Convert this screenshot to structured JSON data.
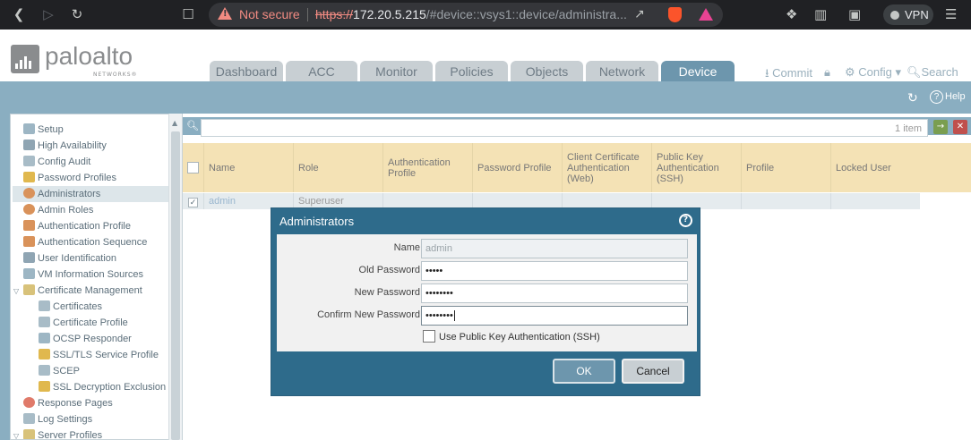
{
  "browser": {
    "not_secure": "Not secure",
    "url_proto": "https://",
    "url_host": "172.20.5.215",
    "url_path": "/#device::vsys1::device/administra...",
    "vpn": "VPN"
  },
  "app": {
    "logo_text": "paloalto",
    "logo_sub": "NETWORKS®",
    "tabs": [
      "Dashboard",
      "ACC",
      "Monitor",
      "Policies",
      "Objects",
      "Network",
      "Device"
    ],
    "active_tab": "Device",
    "commit": "Commit",
    "config": "Config",
    "search": "Search",
    "help": "Help"
  },
  "sidebar": {
    "items": [
      "Setup",
      "High Availability",
      "Config Audit",
      "Password Profiles",
      "Administrators",
      "Admin Roles",
      "Authentication Profile",
      "Authentication Sequence",
      "User Identification",
      "VM Information Sources",
      "Certificate Management",
      "Certificates",
      "Certificate Profile",
      "OCSP Responder",
      "SSL/TLS Service Profile",
      "SCEP",
      "SSL Decryption Exclusion",
      "Response Pages",
      "Log Settings",
      "Server Profiles"
    ],
    "selected": "Administrators"
  },
  "table": {
    "count": "1 item",
    "columns": [
      "Name",
      "Role",
      "Authentication Profile",
      "Password Profile",
      "Client Certificate Authentication (Web)",
      "Public Key Authentication (SSH)",
      "Profile",
      "Locked User"
    ],
    "rows": [
      {
        "name": "admin",
        "role": "Superuser"
      }
    ]
  },
  "dialog": {
    "title": "Administrators",
    "name_label": "Name",
    "name_value": "admin",
    "old_pw_label": "Old Password",
    "old_pw_value": "•••••",
    "new_pw_label": "New Password",
    "new_pw_value": "••••••••",
    "confirm_label": "Confirm New Password",
    "confirm_value": "••••••••",
    "pubkey_label": "Use Public Key Authentication (SSH)",
    "ok": "OK",
    "cancel": "Cancel"
  }
}
